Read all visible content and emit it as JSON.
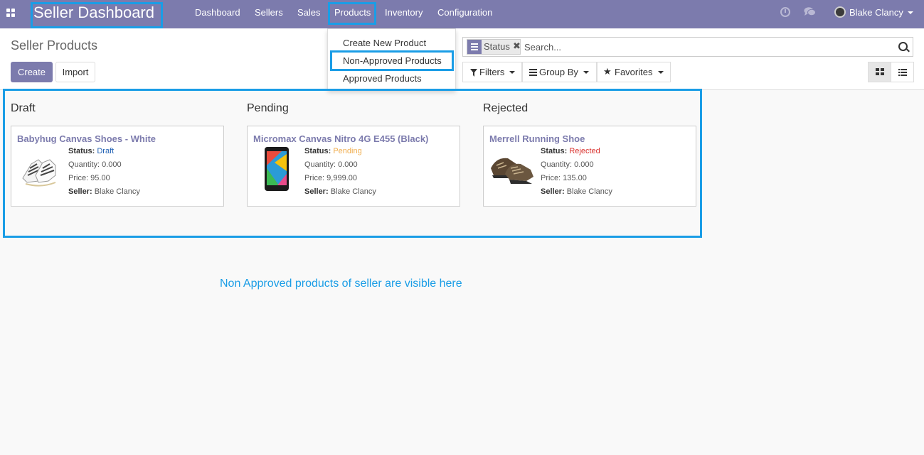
{
  "navbar": {
    "brand": "Seller Dashboard",
    "menu": [
      "Dashboard",
      "Sellers",
      "Sales",
      "Products",
      "Inventory",
      "Configuration"
    ],
    "user": "Blake Clancy",
    "color": "#7c7bad"
  },
  "products_menu": {
    "items": [
      "Create New Product",
      "Non-Approved Products",
      "Approved Products"
    ]
  },
  "control_panel": {
    "title": "Seller Products",
    "create_label": "Create",
    "import_label": "Import",
    "search": {
      "facet": "Status",
      "placeholder": "Search..."
    },
    "filters_label": "Filters",
    "group_by_label": "Group By",
    "favorites_label": "Favorites"
  },
  "kanban": {
    "columns": [
      {
        "title": "Draft",
        "card": {
          "name": "Babyhug Canvas Shoes - White",
          "status_label": "Status:",
          "status": "Draft",
          "quantity": "Quantity: 0.000",
          "price": "Price: 95.00",
          "seller_label": "Seller:",
          "seller": "Blake Clancy"
        }
      },
      {
        "title": "Pending",
        "card": {
          "name": "Micromax Canvas Nitro 4G E455 (Black)",
          "status_label": "Status:",
          "status": "Pending",
          "quantity": "Quantity: 0.000",
          "price": "Price: 9,999.00",
          "seller_label": "Seller:",
          "seller": "Blake Clancy"
        }
      },
      {
        "title": "Rejected",
        "card": {
          "name": "Merrell Running Shoe",
          "status_label": "Status:",
          "status": "Rejected",
          "quantity": "Quantity: 0.000",
          "price": "Price: 135.00",
          "seller_label": "Seller:",
          "seller": "Blake Clancy"
        }
      }
    ]
  },
  "annotation": "Non Approved products of seller are visible here",
  "highlight_color": "#1a9de6"
}
